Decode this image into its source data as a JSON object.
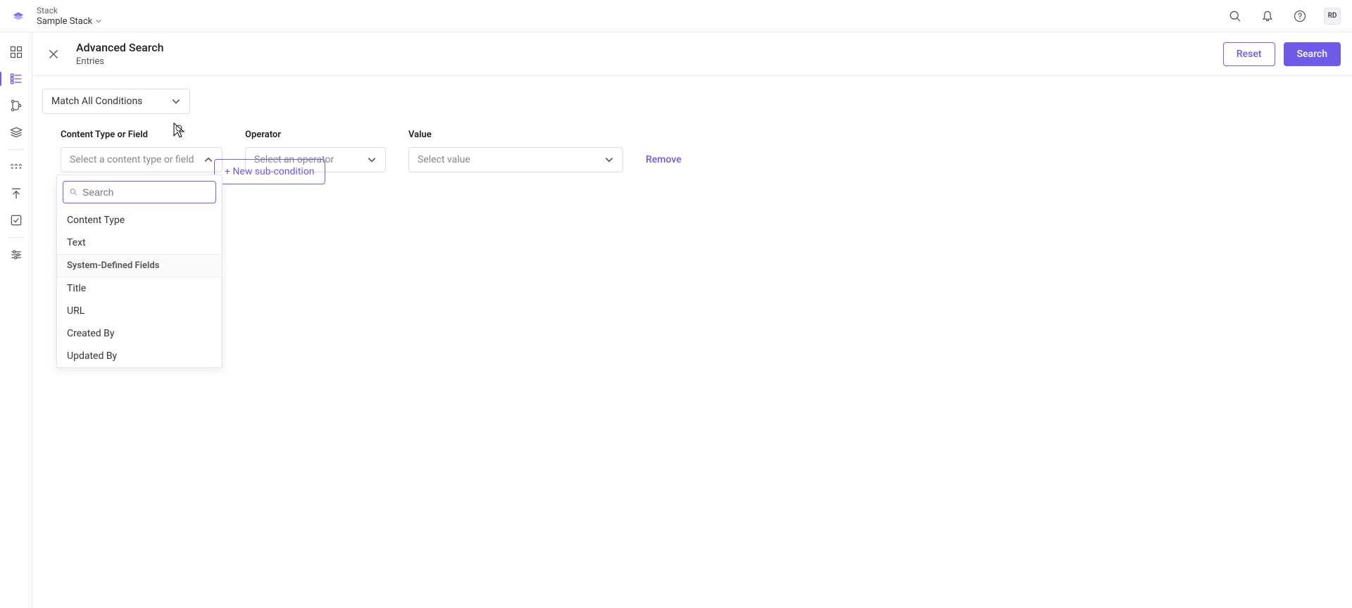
{
  "header": {
    "stack_label": "Stack",
    "stack_name": "Sample Stack",
    "avatar": "RD"
  },
  "page": {
    "title": "Advanced Search",
    "subtitle": "Entries",
    "reset": "Reset",
    "search": "Search"
  },
  "match_select": "Match All Conditions",
  "columns": {
    "field_label": "Content Type or Field",
    "field_placeholder": "Select a content type or field",
    "operator_label": "Operator",
    "operator_placeholder": "Select an operator",
    "value_label": "Value",
    "value_placeholder": "Select value",
    "remove": "Remove",
    "sub_condition": "+ New sub-condition"
  },
  "dropdown": {
    "search_placeholder": "Search",
    "group1_header": "Content Type",
    "group1_items": [
      "Content Type",
      "Text"
    ],
    "group2_header": "System-Defined Fields",
    "group2_items": [
      "Title",
      "URL",
      "Created By",
      "Updated By"
    ]
  }
}
